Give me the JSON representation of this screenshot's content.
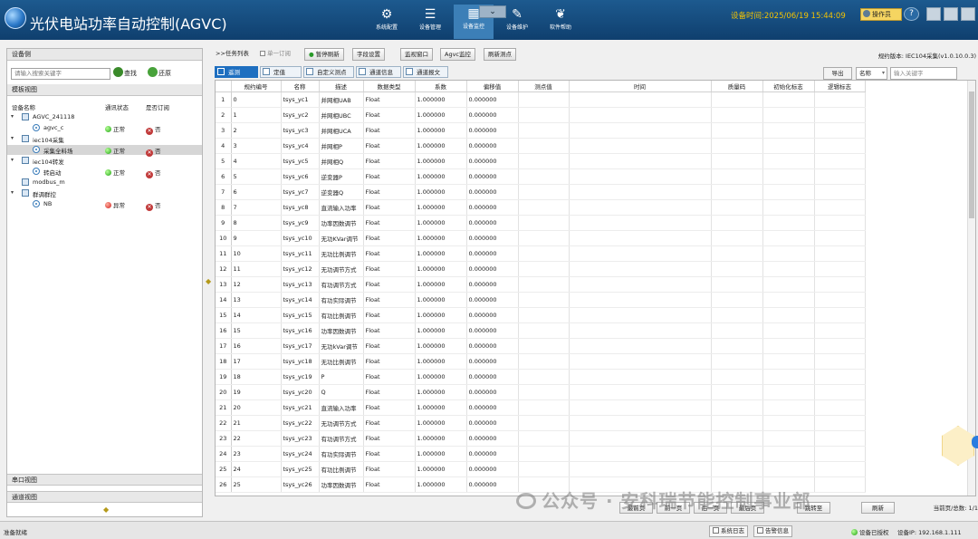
{
  "app": {
    "title": "光伏电站功率自动控制(AGVC)",
    "device_time": "设备时间:2025/06/19 15:44:09",
    "operator": "操作员"
  },
  "nav": [
    {
      "label": "系统配置",
      "icon": "gear-icon",
      "glyph": "⚙"
    },
    {
      "label": "设备管理",
      "icon": "device-manage-icon",
      "glyph": "☰"
    },
    {
      "label": "设备监控",
      "icon": "monitor-icon",
      "glyph": "▦"
    },
    {
      "label": "设备维护",
      "icon": "wrench-icon",
      "glyph": "✎"
    },
    {
      "label": "软件帮助",
      "icon": "help-icon",
      "glyph": "❦"
    }
  ],
  "left": {
    "device_side": "设备侧",
    "search_placeholder": "请输入搜索关键字",
    "find": "查找",
    "restore": "还原",
    "template_view": "模板视图",
    "col_name": "设备名称",
    "col_status": "通讯状态",
    "col_subscribed": "是否订阅",
    "tree": [
      {
        "name": "AGVC_241118",
        "type": "device",
        "status": "",
        "sub": ""
      },
      {
        "name": "agvc_c",
        "type": "channel",
        "status": "正常",
        "status_color": "green",
        "sub": "否"
      },
      {
        "name": "iec104采集",
        "type": "device",
        "status": "",
        "sub": ""
      },
      {
        "name": "采集全料场",
        "type": "channel",
        "status": "正常",
        "status_color": "green",
        "sub": "否"
      },
      {
        "name": "iec104转发",
        "type": "device",
        "status": "",
        "sub": ""
      },
      {
        "name": "转启动",
        "type": "channel",
        "status": "正常",
        "status_color": "green",
        "sub": "否"
      },
      {
        "name": "modbus_m",
        "type": "device",
        "status": "",
        "sub": ""
      },
      {
        "name": "群调群控",
        "type": "device",
        "status": "",
        "sub": ""
      },
      {
        "name": "NB",
        "type": "channel",
        "status": "异常",
        "status_color": "red",
        "sub": "否"
      }
    ],
    "serial_view": "串口视图",
    "channel_view": "通道视图"
  },
  "toolbar": {
    "task_list": ">>任务列表",
    "single_subscribe": "单一订阅",
    "pause_refresh": "暂停刷新",
    "field_setting": "字段设置",
    "monitor_window": "监视窗口",
    "agvc_monitor": "Agvc监控",
    "refresh_points": "刷新测点",
    "spec_version": "规约版本: IEC104采集(v1.0.10.0.3)"
  },
  "tabs": [
    "遥测",
    "定值",
    "自定义测点",
    "通道信息",
    "通道报文"
  ],
  "filter": {
    "export": "导出",
    "field": "名称",
    "keyword_placeholder": "输入关键字"
  },
  "table": {
    "headers": [
      "",
      "规约编号",
      "名称",
      "描述",
      "数据类型",
      "系数",
      "偏移值",
      "测点值",
      "时间",
      "质量码",
      "初始化标志",
      "逻辑标志"
    ],
    "rows": [
      [
        "1",
        "0",
        "tsys_yc1",
        "并网相UAB",
        "Float",
        "1.000000",
        "0.000000"
      ],
      [
        "2",
        "1",
        "tsys_yc2",
        "并网相UBC",
        "Float",
        "1.000000",
        "0.000000"
      ],
      [
        "3",
        "2",
        "tsys_yc3",
        "并网相UCA",
        "Float",
        "1.000000",
        "0.000000"
      ],
      [
        "4",
        "3",
        "tsys_yc4",
        "并网相P",
        "Float",
        "1.000000",
        "0.000000"
      ],
      [
        "5",
        "4",
        "tsys_yc5",
        "并网相Q",
        "Float",
        "1.000000",
        "0.000000"
      ],
      [
        "6",
        "5",
        "tsys_yc6",
        "逆变器P",
        "Float",
        "1.000000",
        "0.000000"
      ],
      [
        "7",
        "6",
        "tsys_yc7",
        "逆变器Q",
        "Float",
        "1.000000",
        "0.000000"
      ],
      [
        "8",
        "7",
        "tsys_yc8",
        "直流输入功率",
        "Float",
        "1.000000",
        "0.000000"
      ],
      [
        "9",
        "8",
        "tsys_yc9",
        "功率因数调节",
        "Float",
        "1.000000",
        "0.000000"
      ],
      [
        "10",
        "9",
        "tsys_yc10",
        "无功KVar调节",
        "Float",
        "1.000000",
        "0.000000"
      ],
      [
        "11",
        "10",
        "tsys_yc11",
        "无功比例调节",
        "Float",
        "1.000000",
        "0.000000"
      ],
      [
        "12",
        "11",
        "tsys_yc12",
        "无功调节方式",
        "Float",
        "1.000000",
        "0.000000"
      ],
      [
        "13",
        "12",
        "tsys_yc13",
        "有功调节方式",
        "Float",
        "1.000000",
        "0.000000"
      ],
      [
        "14",
        "13",
        "tsys_yc14",
        "有功实际调节",
        "Float",
        "1.000000",
        "0.000000"
      ],
      [
        "15",
        "14",
        "tsys_yc15",
        "有功比例调节",
        "Float",
        "1.000000",
        "0.000000"
      ],
      [
        "16",
        "15",
        "tsys_yc16",
        "功率因数调节",
        "Float",
        "1.000000",
        "0.000000"
      ],
      [
        "17",
        "16",
        "tsys_yc17",
        "无功kVar调节",
        "Float",
        "1.000000",
        "0.000000"
      ],
      [
        "18",
        "17",
        "tsys_yc18",
        "无功比例调节",
        "Float",
        "1.000000",
        "0.000000"
      ],
      [
        "19",
        "18",
        "tsys_yc19",
        "P",
        "Float",
        "1.000000",
        "0.000000"
      ],
      [
        "20",
        "19",
        "tsys_yc20",
        "Q",
        "Float",
        "1.000000",
        "0.000000"
      ],
      [
        "21",
        "20",
        "tsys_yc21",
        "直流输入功率",
        "Float",
        "1.000000",
        "0.000000"
      ],
      [
        "22",
        "21",
        "tsys_yc22",
        "无功调节方式",
        "Float",
        "1.000000",
        "0.000000"
      ],
      [
        "23",
        "22",
        "tsys_yc23",
        "有功调节方式",
        "Float",
        "1.000000",
        "0.000000"
      ],
      [
        "24",
        "23",
        "tsys_yc24",
        "有功实际调节",
        "Float",
        "1.000000",
        "0.000000"
      ],
      [
        "25",
        "24",
        "tsys_yc25",
        "有功比例调节",
        "Float",
        "1.000000",
        "0.000000"
      ],
      [
        "26",
        "25",
        "tsys_yc26",
        "功率因数调节",
        "Float",
        "1.000000",
        "0.000000"
      ]
    ]
  },
  "pager": {
    "first": "最前页",
    "prev": "前一页",
    "next": "后一页",
    "last": "最后页",
    "jump": "跳转至",
    "jump_tail": "刷新",
    "page_info": "当前页/总数: 1/1"
  },
  "status": {
    "ready": "准备就绪",
    "system_log": "系统日志",
    "alarm_info": "告警信息",
    "auth": "设备已授权",
    "ip": "设备IP: 192.168.1.111"
  },
  "watermark": "公众号 · 安科瑞节能控制事业部"
}
